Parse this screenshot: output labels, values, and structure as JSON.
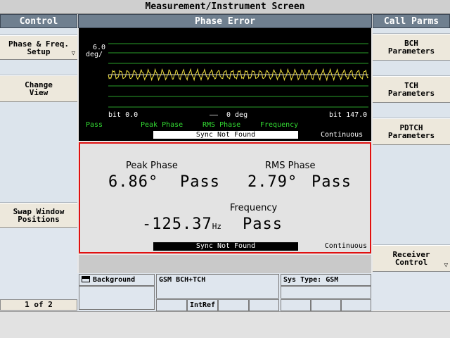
{
  "window": {
    "title": "Measurement/Instrument Screen"
  },
  "left_panel": {
    "header": "Control",
    "buttons": [
      {
        "line1": "Phase & Freq.",
        "line2": "Setup"
      },
      {
        "line1": "Change",
        "line2": "View"
      },
      {
        "line1": "Swap Window",
        "line2": "Positions"
      }
    ],
    "pager": "1 of 2"
  },
  "right_panel": {
    "header": "Call Parms",
    "buttons": [
      {
        "line1": "BCH",
        "line2": "Parameters"
      },
      {
        "line1": "TCH",
        "line2": "Parameters"
      },
      {
        "line1": "PDTCH",
        "line2": "Parameters"
      },
      {
        "line1": "Receiver",
        "line2": "Control"
      }
    ]
  },
  "center": {
    "header": "Phase Error",
    "graph": {
      "y_scale_value": "6.0",
      "y_scale_unit": "deg/",
      "x_start": "bit 0.0",
      "x_end": "bit 147.0",
      "ref_label": "0 deg",
      "legend": {
        "pass": "Pass",
        "peak": "Peak Phase",
        "rms": "RMS Phase",
        "freq": "Frequency"
      },
      "status": "Sync Not Found",
      "mode": "Continuous"
    },
    "results": {
      "peak_phase": {
        "label": "Peak Phase",
        "value": "6.86°",
        "verdict": "Pass"
      },
      "rms_phase": {
        "label": "RMS Phase",
        "value": "2.79°",
        "verdict": "Pass"
      },
      "frequency": {
        "label": "Frequency",
        "value": "-125.37",
        "unit": "Hz",
        "verdict": "Pass"
      },
      "status": "Sync Not Found",
      "mode": "Continuous"
    }
  },
  "bottom": {
    "background_label": "Background",
    "call_label": "GSM BCH+TCH",
    "sys_type": "Sys Type: GSM",
    "intref": "IntRef"
  },
  "colors": {
    "trace": "#f0e040",
    "grid": "#2aa02a",
    "pass_text": "#33dd33",
    "header_bg": "#6f7f8f",
    "alert_border": "#e01010"
  }
}
